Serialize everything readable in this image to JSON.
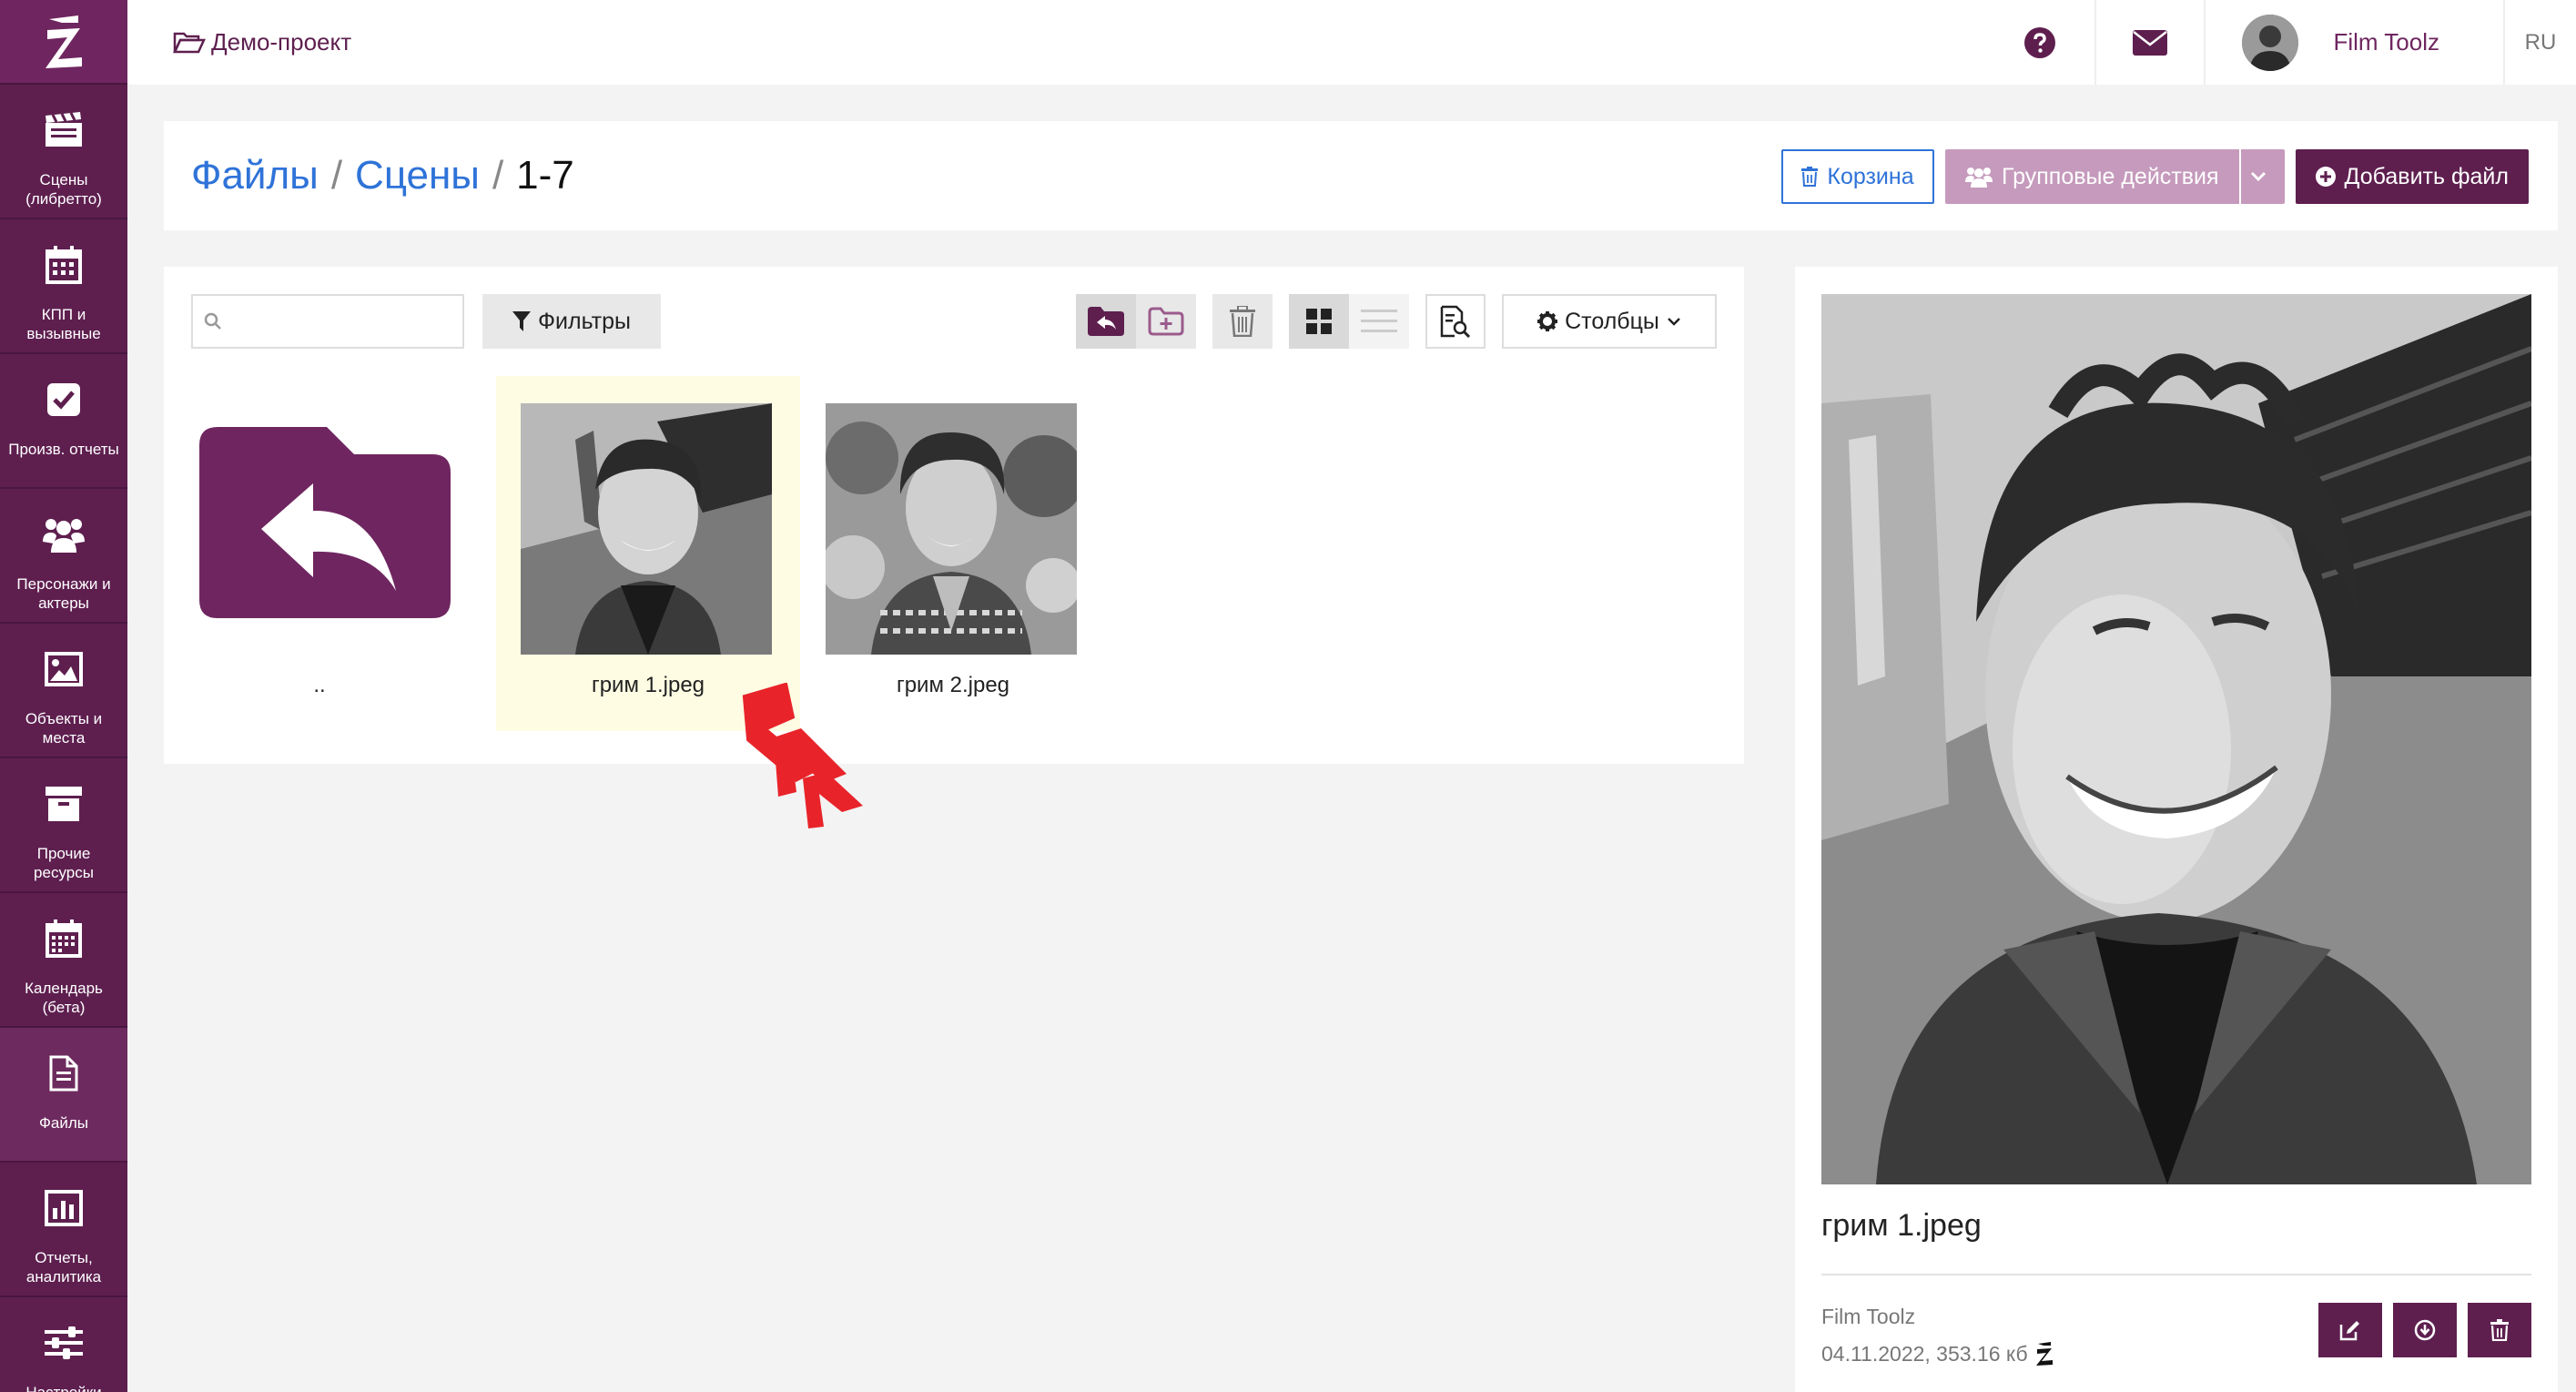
{
  "app": {
    "brand_letter": "Z"
  },
  "sidebar": {
    "items": [
      {
        "label": "Сцены\n(либретто)",
        "icon": "clapperboard-icon"
      },
      {
        "label": "КПП и\nвызывные",
        "icon": "calendar-icon"
      },
      {
        "label": "Произв. отчеты",
        "icon": "checkbox-icon"
      },
      {
        "label": "Персонажи и\nактеры",
        "icon": "users-icon"
      },
      {
        "label": "Объекты и\nместа",
        "icon": "image-icon"
      },
      {
        "label": "Прочие\nресурсы",
        "icon": "archive-icon"
      },
      {
        "label": "Календарь\n(бета)",
        "icon": "calendar-grid-icon"
      },
      {
        "label": "Файлы",
        "icon": "file-icon",
        "active": true
      },
      {
        "label": "Отчеты,\nаналитика",
        "icon": "bar-chart-icon"
      },
      {
        "label": "Настройки",
        "icon": "sliders-icon"
      }
    ]
  },
  "topbar": {
    "project": "Демо-проект",
    "user_name": "Film Toolz",
    "language": "RU"
  },
  "breadcrumb": {
    "root": "Файлы",
    "parent": "Сцены",
    "current": "1-7",
    "separator": "/"
  },
  "header_actions": {
    "trash": "Корзина",
    "group": "Групповые действия",
    "add": "Добавить файл"
  },
  "toolbar": {
    "search_value": "",
    "filters": "Фильтры",
    "columns": "Столбцы"
  },
  "files": [
    {
      "name": "..",
      "type": "folder-up"
    },
    {
      "name": "грим 1.jpeg",
      "type": "image",
      "selected": true
    },
    {
      "name": "грим 2.jpeg",
      "type": "image",
      "selected": false
    }
  ],
  "preview": {
    "file_name": "грим 1.jpeg",
    "owner": "Film Toolz",
    "meta": "04.11.2022, 353.16 кб"
  },
  "colors": {
    "brand": "#5e1f4f",
    "link": "#2f73d8",
    "group_button": "#c59abc",
    "selected_tile": "#fefde4",
    "annotation_arrow": "#e8242a"
  }
}
